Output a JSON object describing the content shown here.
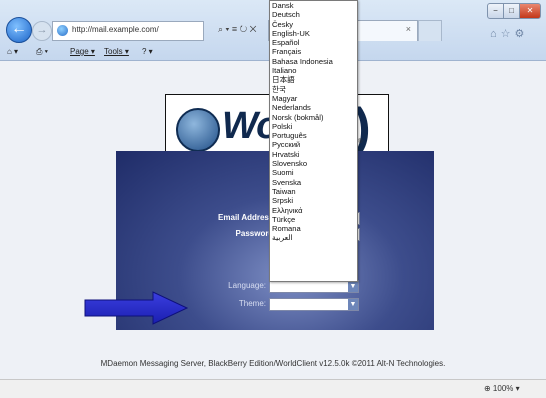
{
  "browser": {
    "address": "http://mail.example.com/",
    "address_tools": "⌕ ▾ ≡ ↻ ✕",
    "tab_close": "×",
    "window_buttons": {
      "min": "−",
      "max": "□",
      "close": "✕"
    },
    "right_icons": "⌂☆⚙",
    "commands": {
      "home": "⌂ ▾",
      "print": "⎙ ▾",
      "page": "Page ▾",
      "tools": "Tools ▾",
      "help": "? ▾"
    },
    "zoom": "⊕ 100%  ▾"
  },
  "logo": {
    "text": "Wor",
    "t_glyph": "t)",
    "small": "®"
  },
  "login": {
    "email_label": "Email Address:",
    "password_label": "Password:",
    "language_label": "Language:",
    "theme_label": "Theme:"
  },
  "footer": "MDaemon Messaging Server, BlackBerry Edition/WorldClient v12.5.0k ©2011 Alt-N Technologies.",
  "languages": [
    "Dansk",
    "Deutsch",
    "Česky",
    "English-UK",
    "Español",
    "Français",
    "Bahasa Indonesia",
    "Italiano",
    "日本語",
    "한국",
    "Magyar",
    "Nederlands",
    "Norsk (bokmål)",
    "Polski",
    "Português",
    "Русский",
    "Hrvatski",
    "Slovensko",
    "Suomi",
    "Svenska",
    "Taiwan",
    "Srpski",
    "Ελληνικά",
    "Türkçe",
    "Romana",
    "العربية"
  ]
}
